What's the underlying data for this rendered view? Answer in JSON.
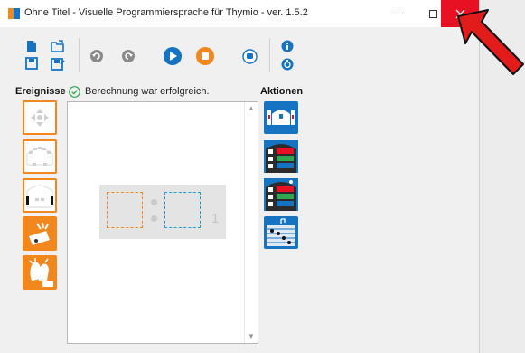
{
  "window": {
    "title": "Ohne Titel - Visuelle Programmiersprache für Thymio - ver. 1.5.2"
  },
  "labels": {
    "events": "Ereignisse",
    "actions": "Aktionen"
  },
  "status": {
    "message": "Berechnung war erfolgreich."
  },
  "program": {
    "pair_number": "1"
  },
  "colors": {
    "event_orange": "#f2871e",
    "action_blue": "#1673c2",
    "close_red": "#e81123",
    "success_green": "#2fa84f"
  }
}
